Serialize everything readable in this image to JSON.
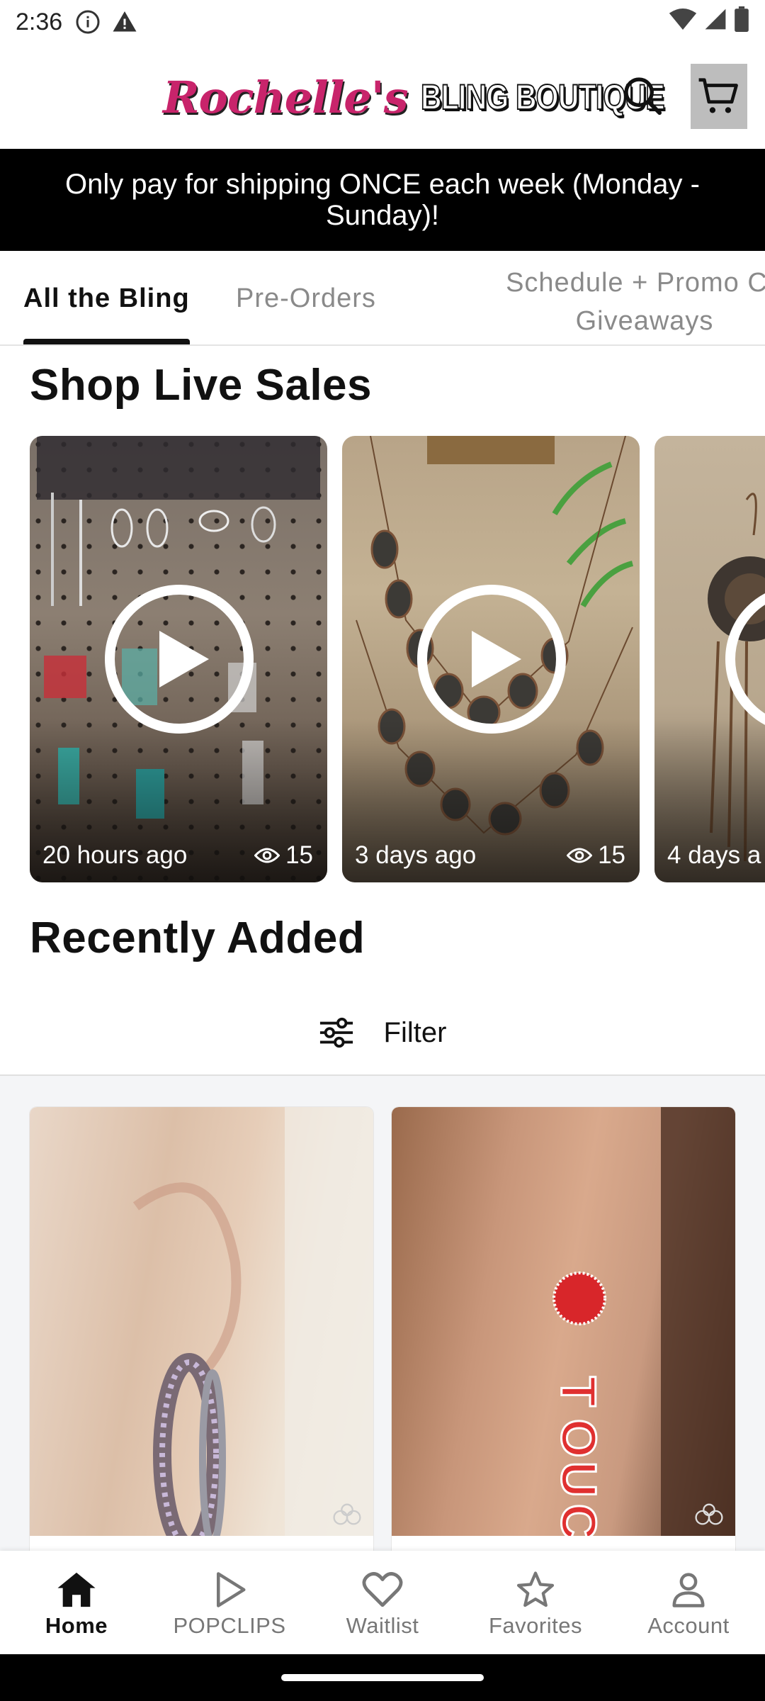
{
  "status_bar": {
    "time": "2:36"
  },
  "header": {
    "logo_script": "Rochelle's",
    "logo_block": "BLING BOUTIQUE"
  },
  "announcement": "Only pay for shipping ONCE each week (Monday - Sunday)!",
  "tabs": [
    {
      "label": "All the Bling",
      "active": true
    },
    {
      "label": "Pre-Orders",
      "active": false
    },
    {
      "label": "Schedule + Promo Co... Giveaways",
      "line1": "Schedule + Promo Co",
      "line2": "Giveaways",
      "active": false
    }
  ],
  "live_sales": {
    "title": "Shop Live Sales",
    "cards": [
      {
        "time": "20 hours ago",
        "views": "15"
      },
      {
        "time": "3 days ago",
        "views": "15"
      },
      {
        "time": "4 days a",
        "views": ""
      }
    ]
  },
  "recent": {
    "title": "Recently Added",
    "filter_label": "Filter"
  },
  "bottom_nav": [
    {
      "label": "Home",
      "icon": "home-icon",
      "active": true
    },
    {
      "label": "POPCLIPS",
      "icon": "play-icon",
      "active": false
    },
    {
      "label": "Waitlist",
      "icon": "heart-icon",
      "active": false
    },
    {
      "label": "Favorites",
      "icon": "star-icon",
      "active": false
    },
    {
      "label": "Account",
      "icon": "person-icon",
      "active": false
    }
  ],
  "colors": {
    "brand_pink": "#c8246b",
    "announcement_bg": "#000000",
    "cart_bg": "#bdbdbd"
  }
}
